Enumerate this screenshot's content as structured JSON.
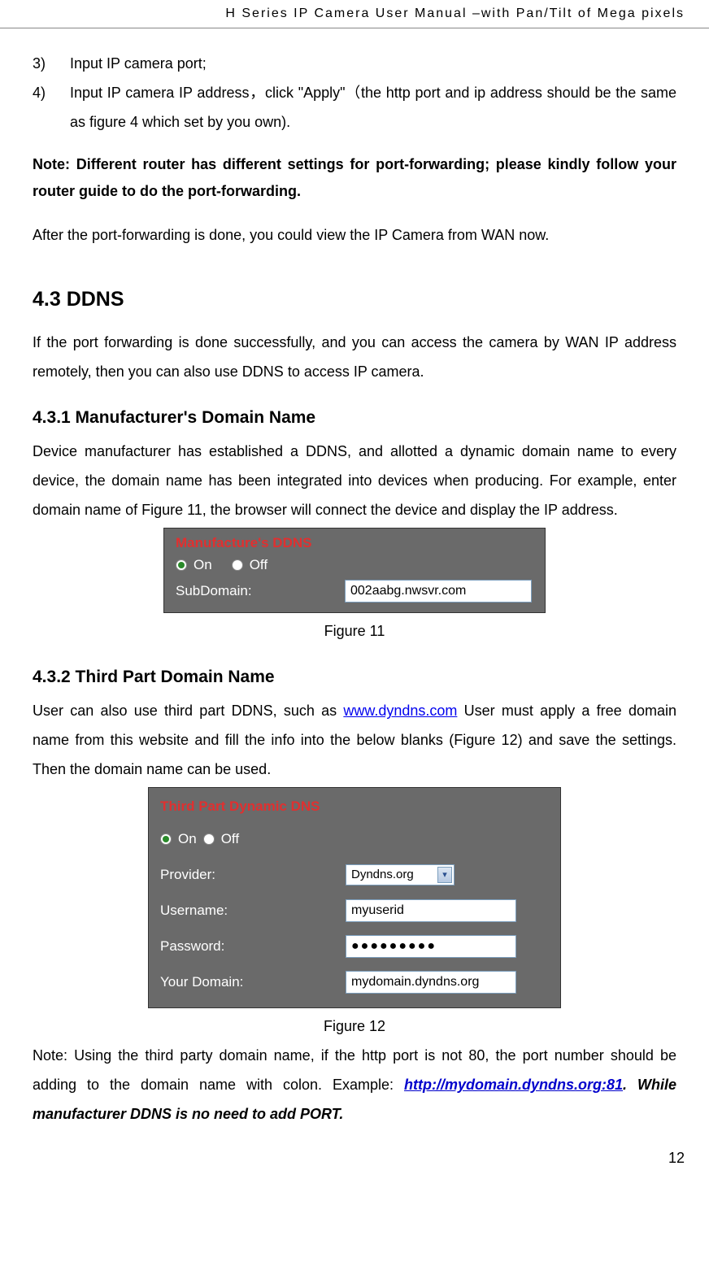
{
  "header": "H  Series  IP  Camera  User  Manual  –with  Pan/Tilt  of  Mega  pixels",
  "list": {
    "n3": "3)",
    "t3": "Input IP camera port;",
    "n4": "4)",
    "t4": "Input IP camera IP address，click \"Apply\"（the http port and ip address should be the same as figure 4 which set by you own)."
  },
  "note1": "Note:  Different  router  has  different  settings  for  port-forwarding;  please  kindly follow your router guide to do the port-forwarding.",
  "after_note": "After the port-forwarding is done, you could view the IP Camera from WAN now.",
  "sec43_title": "4.3   DDNS",
  "sec43_intro": "If  the  port  forwarding  is  done  successfully,  and  you  can  access  the  camera  by  WAN  IP address remotely, then you can also use DDNS to access IP camera.",
  "sec431_title": "4.3.1   Manufacturer's Domain Name",
  "sec431_body": "Device manufacturer has established a DDNS, and allotted a dynamic domain name to every device, the domain name has been integrated into devices when producing. For example, enter  domain  name  of  Figure  11,  the  browser  will  connect  the  device  and  display  the  IP address.",
  "fig11": {
    "panel_title": "Manufacture's DDNS",
    "on": "On",
    "off": "Off",
    "sub_label": "SubDomain:",
    "sub_value": "002aabg.nwsvr.com",
    "caption": "Figure 11"
  },
  "sec432_title": "4.3.2   Third Part Domain Name",
  "sec432_body_a": "User can also use third part DDNS, such as ",
  "sec432_link": "www.dyndns.com",
  "sec432_body_b": " User must apply a free domain name  from  this  website  and  fill  the  info  into  the  below  blanks  (Figure  12)  and  save  the settings. Then the domain name can be used.",
  "fig12": {
    "panel_title": "Third Part Dynamic DNS",
    "on": "On",
    "off": "Off",
    "provider_label": "Provider:",
    "provider_value": "Dyndns.org",
    "username_label": "Username:",
    "username_value": "myuserid",
    "password_label": "Password:",
    "password_value": "●●●●●●●●●",
    "domain_label": "Your Domain:",
    "domain_value": "mydomain.dyndns.org",
    "caption": "Figure 12"
  },
  "note2_a": "Note: Using the third party domain name, if the http port is not 80, the port number should be adding  to  the  domain  name  with  colon.  Example:  ",
  "note2_link": "http://mydomain.dyndns.org:81",
  "note2_b": ".  While manufacturer DDNS is no need to add PORT.",
  "page_number": "12"
}
